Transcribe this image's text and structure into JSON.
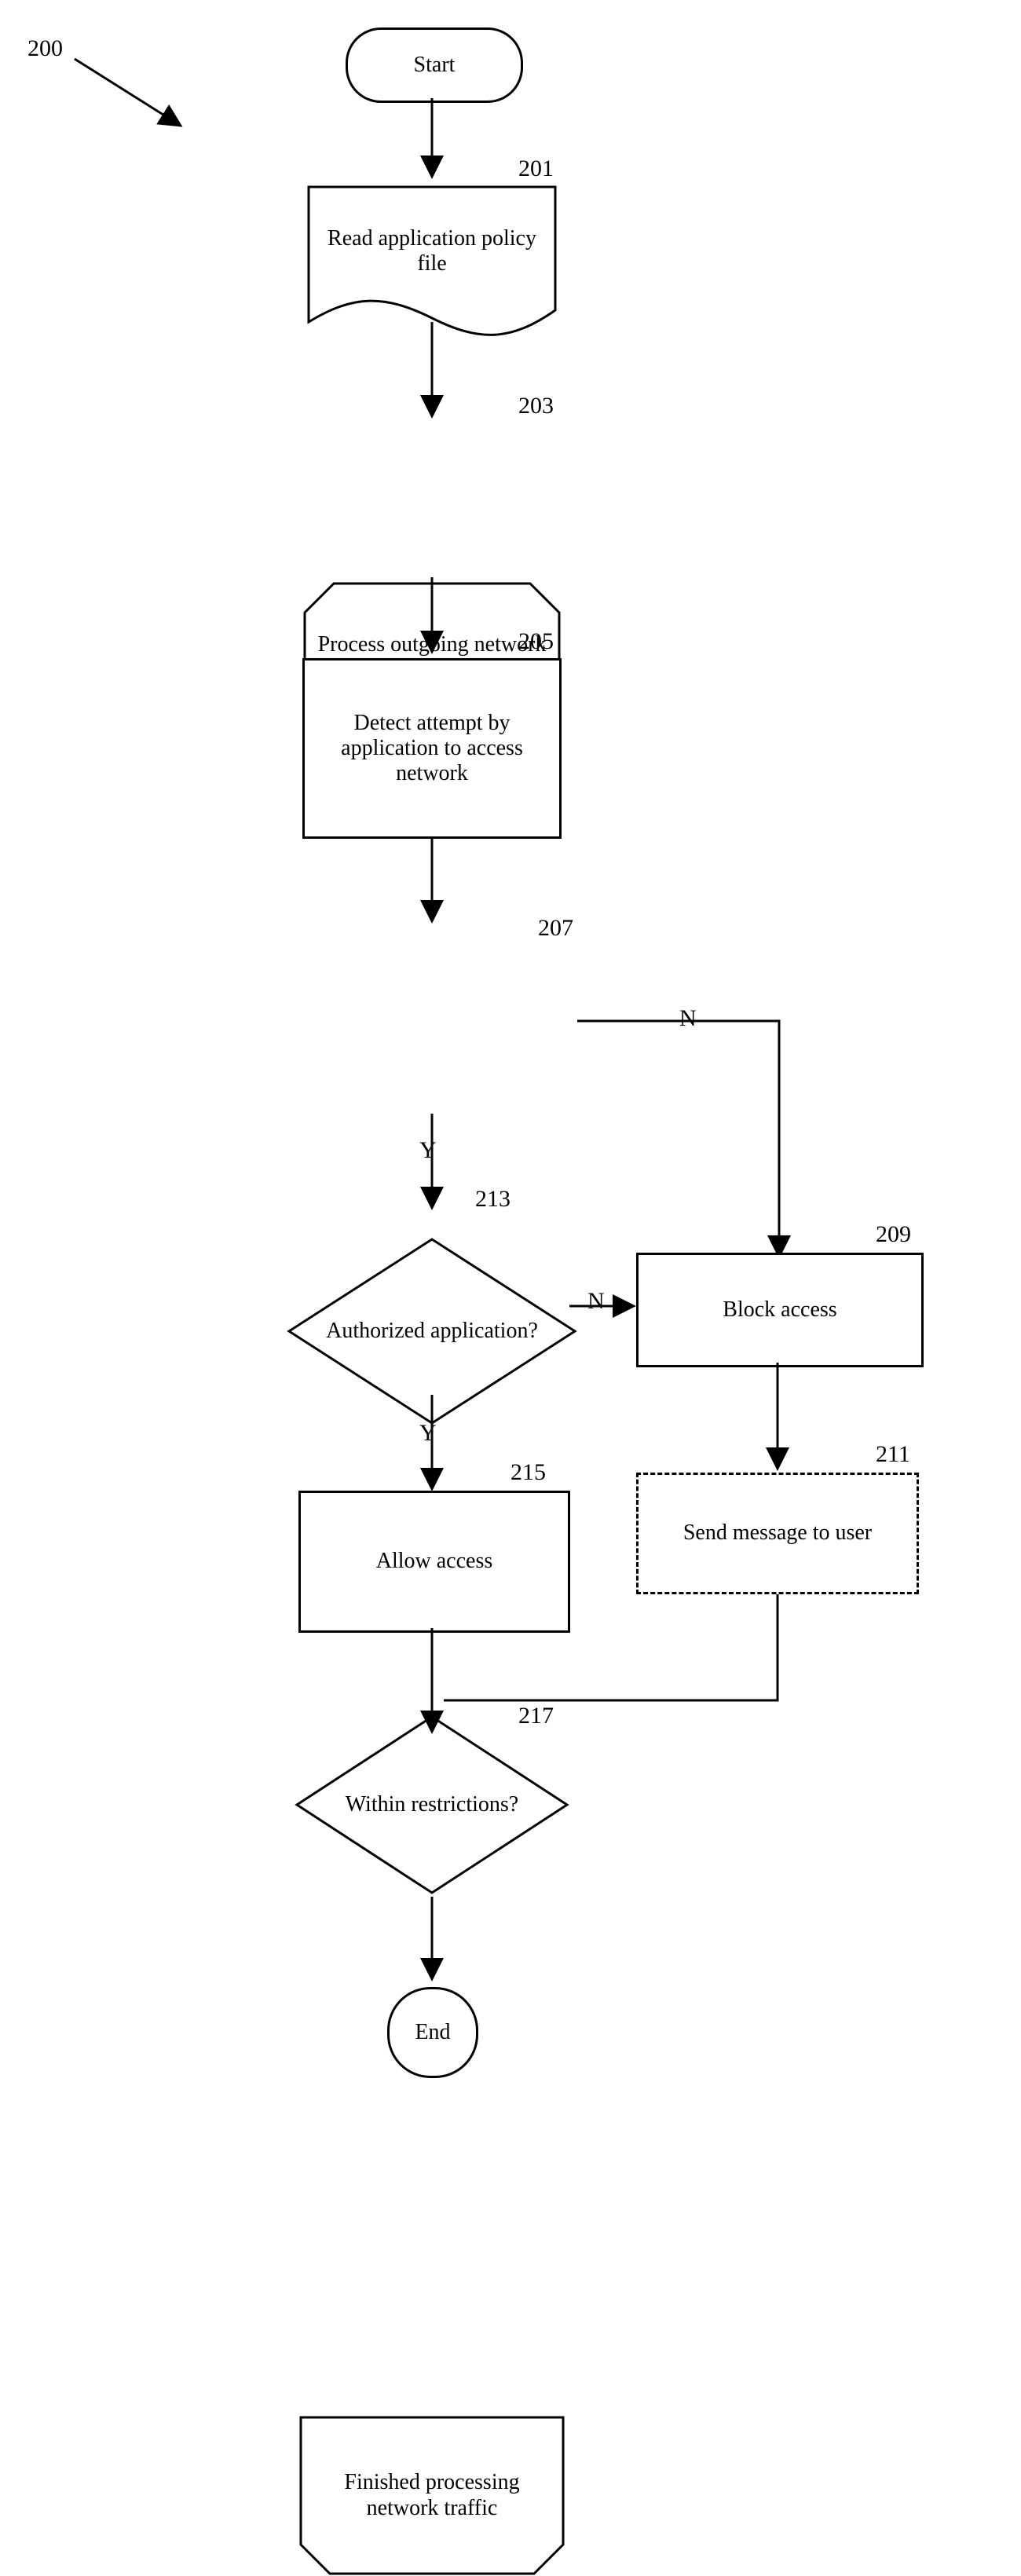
{
  "diagram_ref": "200",
  "nodes": {
    "start": {
      "label": "Start"
    },
    "read": {
      "label": "Read application policy file",
      "ref": "201"
    },
    "proc": {
      "label": "Process outgoing network traffic",
      "ref": "203"
    },
    "detect": {
      "label": "Detect attempt by application to access network",
      "ref": "205"
    },
    "auth": {
      "label": "Authorized application?",
      "ref": "207"
    },
    "within": {
      "label": "Within restrictions?",
      "ref": "213"
    },
    "block": {
      "label": "Block access",
      "ref": "209"
    },
    "send": {
      "label": "Send message to user",
      "ref": "211"
    },
    "allow": {
      "label": "Allow access",
      "ref": "215"
    },
    "finish": {
      "label": "Finished processing network traffic",
      "ref": "217"
    },
    "end": {
      "label": "End"
    }
  },
  "edge_labels": {
    "auth_no": "N",
    "auth_yes": "Y",
    "within_no": "N",
    "within_yes": "Y"
  }
}
